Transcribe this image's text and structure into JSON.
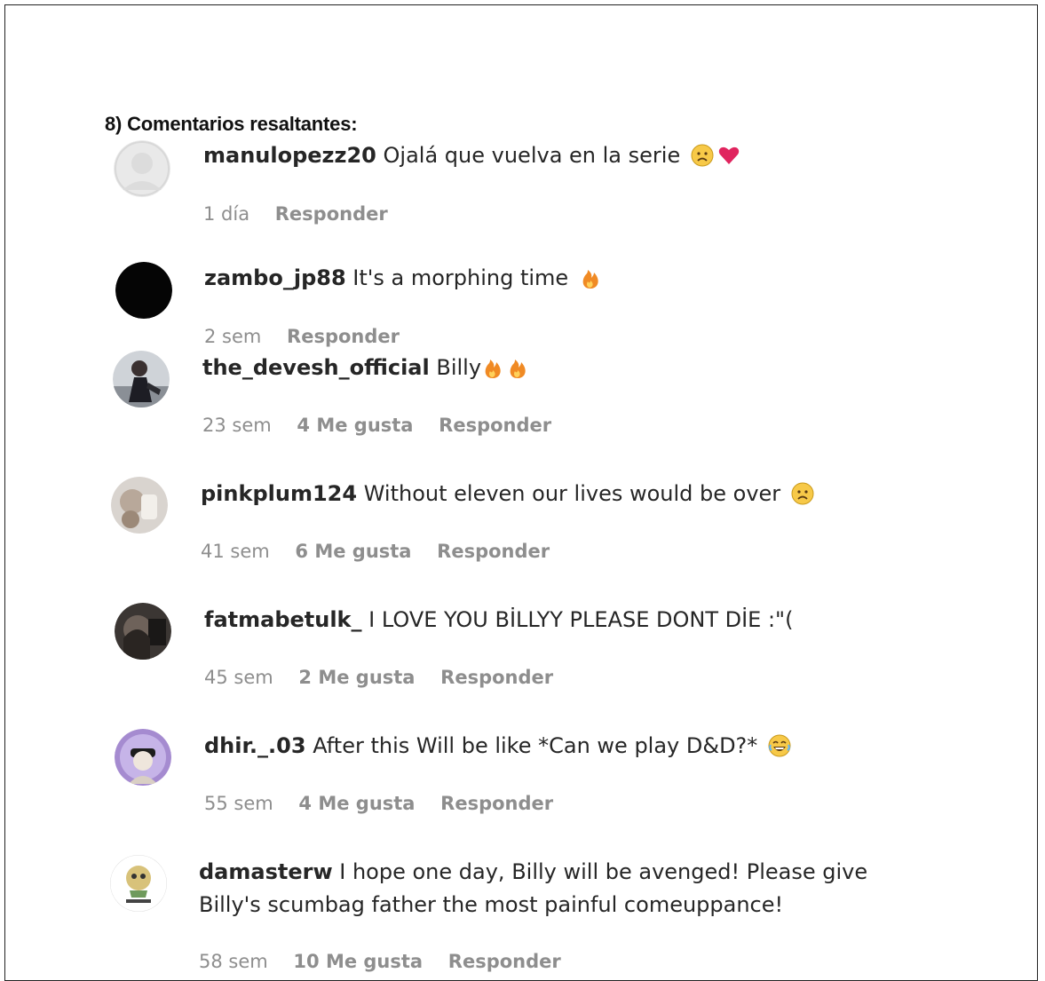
{
  "heading": "8) Comentarios resaltantes:",
  "comments": [
    {
      "user": "manulopezz20",
      "text": "Ojalá que vuelva en la serie",
      "emojis": [
        "sad-face",
        "heart"
      ],
      "time": "1 día",
      "likes": "",
      "reply": "Responder"
    },
    {
      "user": "zambo_jp88",
      "text": "It's a morphing time",
      "emojis": [
        "fire"
      ],
      "time": "2 sem",
      "likes": "",
      "reply": "Responder"
    },
    {
      "user": "the_devesh_official",
      "text": "Billy",
      "emojis": [
        "fire",
        "fire"
      ],
      "time": "23 sem",
      "likes": "4 Me gusta",
      "reply": "Responder"
    },
    {
      "user": "pinkplum124",
      "text": "Without eleven our lives would be over",
      "emojis": [
        "sad-face"
      ],
      "time": "41 sem",
      "likes": "6 Me gusta",
      "reply": "Responder"
    },
    {
      "user": "fatmabetulk_",
      "text": "I LOVE YOU BİLLYY PLEASE DONT DİE :\"(",
      "emojis": [],
      "time": "45 sem",
      "likes": "2 Me gusta",
      "reply": "Responder"
    },
    {
      "user": "dhir._.03",
      "text": "After this Will be like *Can we play D&D?*",
      "emojis": [
        "laughing-face"
      ],
      "time": "55 sem",
      "likes": "4 Me gusta",
      "reply": "Responder"
    },
    {
      "user": "damasterw",
      "text": "I hope one day, Billy will be avenged! Please give",
      "text2": "Billy's scumbag father the most painful comeuppance!",
      "emojis": [],
      "time": "58 sem",
      "likes": "10 Me gusta",
      "reply": "Responder"
    }
  ],
  "colors": {
    "username": "#262626",
    "meta": "#8e8e8e",
    "heart": "#e0245e",
    "fire": "#f08a24",
    "emoji_face": "#f7c948"
  }
}
